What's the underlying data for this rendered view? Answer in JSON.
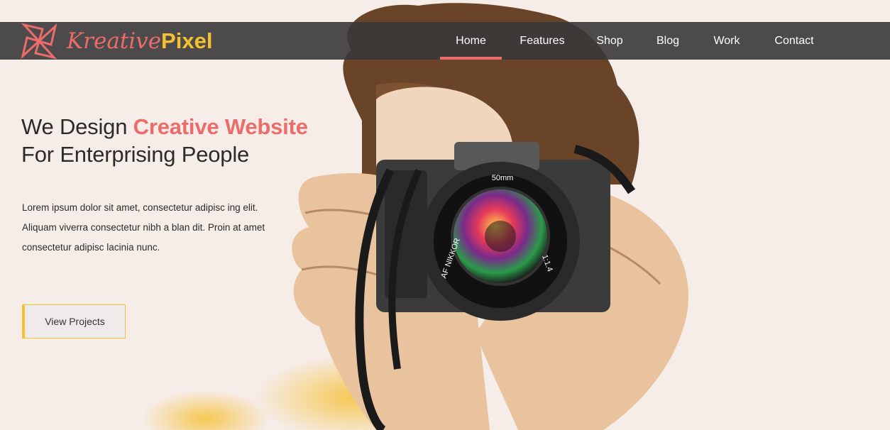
{
  "brand": {
    "name_part1": "Kreative",
    "name_part2": "Pixel",
    "logo_icon": "pinwheel-logo-icon"
  },
  "nav": {
    "items": [
      {
        "label": "Home",
        "active": true
      },
      {
        "label": "Features",
        "active": false
      },
      {
        "label": "Shop",
        "active": false
      },
      {
        "label": "Blog",
        "active": false
      },
      {
        "label": "Work",
        "active": false
      },
      {
        "label": "Contact",
        "active": false
      }
    ]
  },
  "hero": {
    "title_prefix": "We Design ",
    "title_accent": "Creative Website",
    "title_line2": "For Enterprising People",
    "body_line1": "Lorem ipsum dolor sit amet, consectetur adipisc ing elit.",
    "body_line2": "Aliquam viverra consectetur nibh a blan dit. Proin at amet",
    "body_line3": "consectetur adipisc lacinia nunc.",
    "cta_label": "View Projects"
  },
  "camera": {
    "lens_top_label": "50mm",
    "lens_left_label": "AF NIKKOR",
    "lens_right_label": "1:1.4"
  },
  "colors": {
    "accent": "#ec6b6b",
    "brand_yellow": "#f4c230",
    "navbar_bg": "#3a3838",
    "page_bg": "#f6ece8"
  }
}
